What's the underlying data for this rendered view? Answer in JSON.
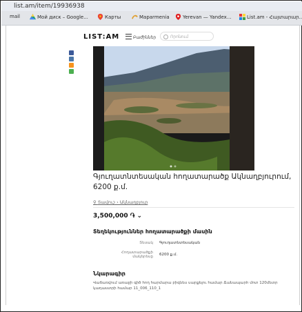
{
  "browser": {
    "url": "list.am/item/19936938",
    "bookmarks": [
      {
        "label": "mail",
        "icon": ""
      },
      {
        "label": "Мой диск – Google...",
        "icon": "drive-icon"
      },
      {
        "label": "Карты",
        "icon": "maps-pin-icon"
      },
      {
        "label": "Maparmenia",
        "icon": "maparmenia-icon"
      },
      {
        "label": "Yerevan — Yandex...",
        "icon": "yandex-pin-icon"
      },
      {
        "label": "List.am - Հայտարար...",
        "icon": "listam-icon"
      }
    ]
  },
  "header": {
    "logo": "LIST:AM",
    "menu_label": "Բաժիններ",
    "search_placeholder": "Որոնում"
  },
  "listing": {
    "title": "Գյուղատնտեսական հողատարածք Ակնաղբյուրում, 6200 ք.մ.",
    "location": "Տավուշ › Ակնաղբյուր",
    "price": "3,500,000 ֏ ⌄",
    "details_heading": "Տեղեկություններ հողատարածքի մասին",
    "attributes": [
      {
        "label": "Տեսակ",
        "value": "Գյուղատնտեսական"
      },
      {
        "label": "Հողատարածքի մակերեսը",
        "value": "6200 ք.մ."
      }
    ],
    "description_heading": "Նկարագիր",
    "description": "Վաճառվում առաջի գիծ հող հարմարա բիզնես սարքելու համար Ճանապարհ մոտ 120մետր կադաստրի համար 11_006_110_1"
  },
  "colors": {
    "facebook": "#3b5998",
    "vk": "#4a76a8",
    "ok": "#f7931e",
    "share": "#4caf50"
  }
}
